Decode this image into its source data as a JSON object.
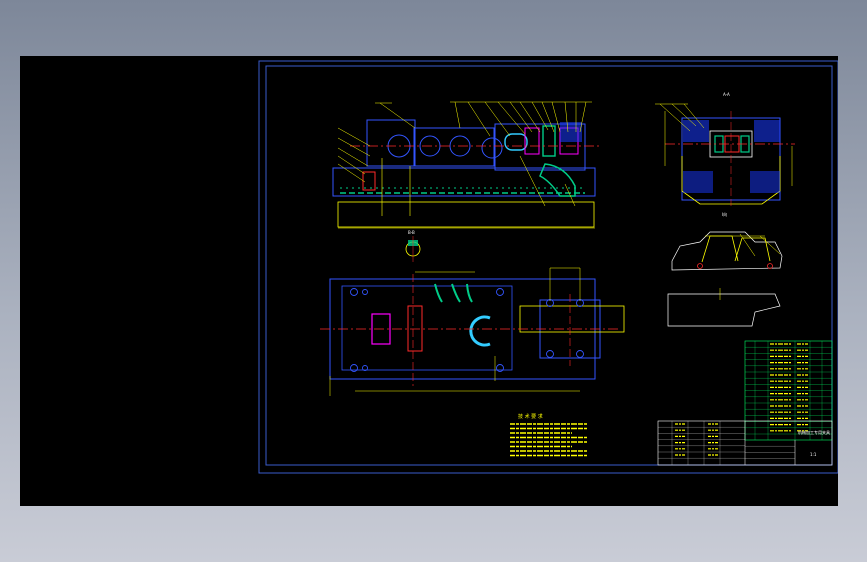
{
  "viewer": {
    "background": "#000000",
    "frame_color": "#3a5ccc",
    "colors": {
      "outline": "#ffff00",
      "detail": "#3355ff",
      "center": "#ff2a2a",
      "hatch": "#00cc88",
      "section": "#ff00ff",
      "text": "#ffffff",
      "table": "#00ff66"
    }
  },
  "drawing": {
    "section_label": "A-A",
    "small_section_label": "B-B",
    "view_caption": "I向",
    "tech_title": "技 术 要 求",
    "title_block": {
      "name": "机械加工专用夹具",
      "scale": "1:1"
    }
  }
}
